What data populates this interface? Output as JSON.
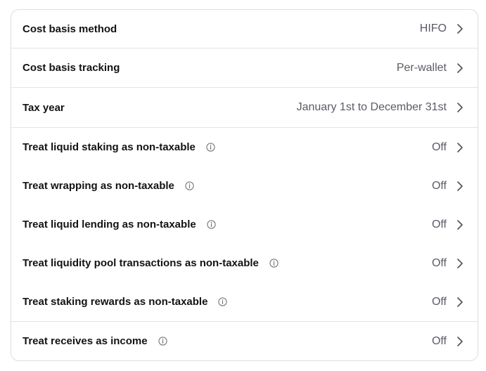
{
  "settings": {
    "cost_basis_method": {
      "label": "Cost basis method",
      "value": "HIFO"
    },
    "cost_basis_tracking": {
      "label": "Cost basis tracking",
      "value": "Per-wallet"
    },
    "tax_year": {
      "label": "Tax year",
      "value": "January 1st to December 31st"
    },
    "liquid_staking": {
      "label": "Treat liquid staking as non-taxable",
      "value": "Off"
    },
    "wrapping": {
      "label": "Treat wrapping as non-taxable",
      "value": "Off"
    },
    "liquid_lending": {
      "label": "Treat liquid lending as non-taxable",
      "value": "Off"
    },
    "liquidity_pool": {
      "label": "Treat liquidity pool transactions as non-taxable",
      "value": "Off"
    },
    "staking_rewards": {
      "label": "Treat staking rewards as non-taxable",
      "value": "Off"
    },
    "receives_income": {
      "label": "Treat receives as income",
      "value": "Off"
    }
  },
  "icons": {
    "info": "info-circle-icon",
    "chevron": "chevron-right-icon"
  },
  "colors": {
    "label": "#131316",
    "value": "#5b5b66",
    "border": "#dcdce4",
    "divider": "#e4e4ea"
  }
}
